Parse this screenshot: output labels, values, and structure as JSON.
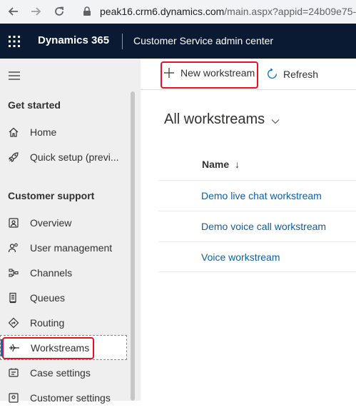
{
  "browser": {
    "url_host": "peak16.crm6.dynamics.com",
    "url_path": "/main.aspx?appid=24b09e75-e"
  },
  "appbar": {
    "brand": "Dynamics 365",
    "app_name": "Customer Service admin center"
  },
  "sidebar": {
    "sections": [
      {
        "title": "Get started"
      },
      {
        "title": "Customer support"
      }
    ],
    "items": [
      {
        "label": "Home",
        "icon": "home-icon"
      },
      {
        "label": "Quick setup (previ...",
        "icon": "rocket-icon"
      },
      {
        "label": "Overview",
        "icon": "overview-icon"
      },
      {
        "label": "User management",
        "icon": "users-icon"
      },
      {
        "label": "Channels",
        "icon": "channels-icon"
      },
      {
        "label": "Queues",
        "icon": "queues-icon"
      },
      {
        "label": "Routing",
        "icon": "routing-icon"
      },
      {
        "label": "Workstreams",
        "icon": "workstreams-icon",
        "active": true
      },
      {
        "label": "Case settings",
        "icon": "case-settings-icon"
      },
      {
        "label": "Customer settings",
        "icon": "customer-settings-icon"
      }
    ]
  },
  "toolbar": {
    "new_label": "New workstream",
    "refresh_label": "Refresh"
  },
  "main": {
    "view_title": "All workstreams",
    "column_name": "Name",
    "sort_indicator": "↓",
    "rows": [
      "Demo live chat workstream",
      "Demo voice call workstream",
      "Voice workstream"
    ]
  },
  "colors": {
    "accent": "#0f6cbd",
    "appbar": "#0b1a33",
    "highlight": "#e81123",
    "link": "#115ea3"
  }
}
